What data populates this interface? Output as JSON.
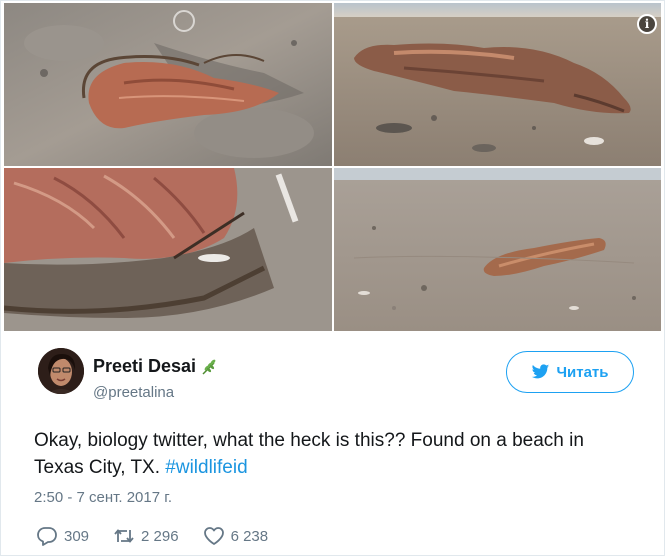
{
  "tweet": {
    "author": {
      "name": "Preeti Desai",
      "handle": "@preetalina",
      "badge_icon": "leaf-icon"
    },
    "follow_button": {
      "label": "Читать",
      "icon": "twitter-bird-icon",
      "color": "#1da1f2"
    },
    "text_main": "Okay, biology twitter, what the heck is this?? Found on a beach in Texas City, TX.",
    "hashtag": "#wildlifeid",
    "hashtag_color": "#1b95e0",
    "timestamp": "2:50 - 7 сент. 2017 г.",
    "stats": {
      "replies": "309",
      "retweets": "2 296",
      "likes": "6 238"
    },
    "media": {
      "photo_count": 4,
      "info_icon": "info-icon"
    }
  }
}
